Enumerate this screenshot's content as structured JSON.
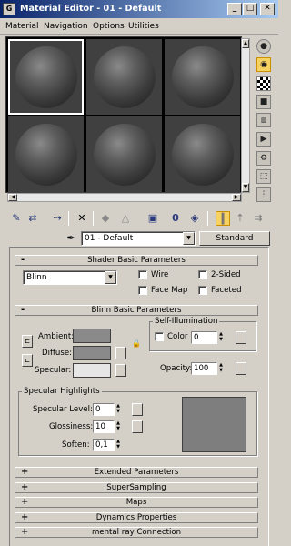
{
  "window": {
    "title": "Material Editor - 01 - Default"
  },
  "menu": [
    "Material",
    "Navigation",
    "Options",
    "Utilities"
  ],
  "material": {
    "name": "01 - Default",
    "type_button": "Standard"
  },
  "shader": {
    "header": "Shader Basic Parameters",
    "shader_type": "Blinn",
    "wire": "Wire",
    "two_sided": "2-Sided",
    "face_map": "Face Map",
    "faceted": "Faceted"
  },
  "blinn": {
    "header": "Blinn Basic Parameters",
    "ambient": "Ambient:",
    "diffuse": "Diffuse:",
    "specular": "Specular:",
    "self_illum_title": "Self-Illumination",
    "color_label": "Color",
    "color_value": "0",
    "opacity_label": "Opacity:",
    "opacity_value": "100",
    "spec_title": "Specular Highlights",
    "spec_level_label": "Specular Level:",
    "spec_level_value": "0",
    "gloss_label": "Glossiness:",
    "gloss_value": "10",
    "soften_label": "Soften:",
    "soften_value": "0,1"
  },
  "rollouts": [
    {
      "sign": "+",
      "label": "Extended Parameters"
    },
    {
      "sign": "+",
      "label": "SuperSampling"
    },
    {
      "sign": "+",
      "label": "Maps"
    },
    {
      "sign": "+",
      "label": "Dynamics Properties"
    },
    {
      "sign": "+",
      "label": "mental ray Connection"
    }
  ],
  "colors": {
    "ambient": "#8a8a8a",
    "diffuse": "#8a8a8a",
    "specular": "#e6e6e6",
    "spec_preview": "#7e7e7e",
    "title_start": "#0a246a",
    "title_end": "#a6caf0"
  },
  "icons": {
    "sidebar": [
      "sample-type-sphere-icon",
      "backlight-icon",
      "background-checker-icon",
      "sample-uv-tiling-icon",
      "video-color-check-icon",
      "make-preview-icon",
      "options-icon",
      "select-by-material-icon",
      "material-map-navigator-icon"
    ],
    "toolbar": [
      "get-material-icon",
      "put-to-scene-icon",
      "assign-to-selection-icon",
      "reset-map-icon",
      "make-copy-icon",
      "make-unique-icon",
      "put-to-library-icon",
      "material-effects-channel-icon",
      "show-map-in-viewport-icon",
      "show-end-result-icon",
      "go-to-parent-icon",
      "go-forward-to-sibling-icon",
      "pick-material-eyedropper-icon"
    ]
  }
}
